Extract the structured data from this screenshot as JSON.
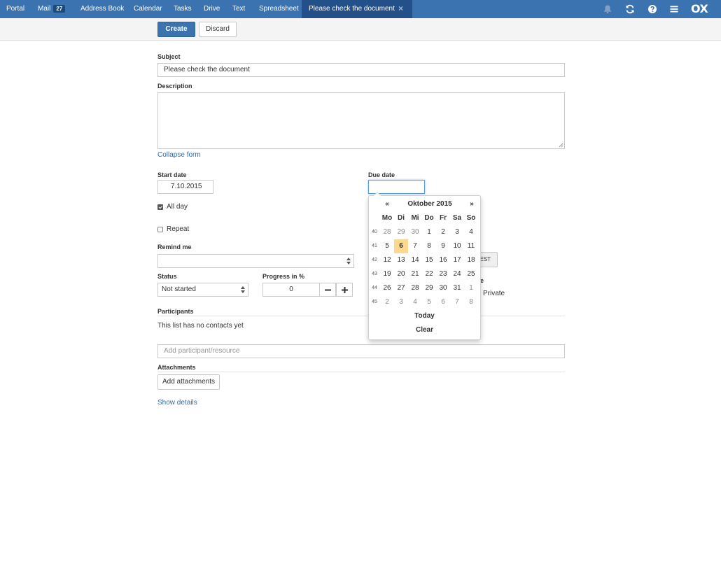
{
  "nav": {
    "items": [
      "Portal",
      "Mail",
      "Address Book",
      "Calendar",
      "Tasks",
      "Drive",
      "Text",
      "Spreadsheet"
    ],
    "mail_badge": "27",
    "active_tab": "Please check the document",
    "close_glyph": "×",
    "icons": [
      "bell-icon",
      "refresh-icon",
      "help-icon",
      "menu-icon"
    ],
    "logo": "OX"
  },
  "toolbar": {
    "create_label": "Create",
    "discard_label": "Discard"
  },
  "form": {
    "subject_label": "Subject",
    "subject_value": "Please check the document",
    "description_label": "Description",
    "collapse_link": "Collapse form",
    "start_date_label": "Start date",
    "start_date_value": "7.10.2015",
    "due_date_label": "Due date",
    "all_day_label": "All day",
    "repeat_label": "Repeat",
    "remind_label": "Remind me",
    "status_label": "Status",
    "status_value": "Not started",
    "progress_label": "Progress in %",
    "progress_value": "0",
    "partial_button": "EST",
    "partial_label": "e",
    "private_label": "Private",
    "participants_label": "Participants",
    "no_contacts": "This list has no contacts yet",
    "participant_placeholder": "Add participant/resource",
    "attachments_label": "Attachments",
    "add_attachments": "Add attachments",
    "show_details": "Show details"
  },
  "datepicker": {
    "prev": "«",
    "next": "»",
    "title": "Oktober 2015",
    "weekdays": [
      "Mo",
      "Di",
      "Mi",
      "Do",
      "Fr",
      "Sa",
      "So"
    ],
    "weeks": [
      {
        "week": "40",
        "days": [
          "28",
          "29",
          "30",
          "1",
          "2",
          "3",
          "4"
        ]
      },
      {
        "week": "41",
        "days": [
          "5",
          "6",
          "7",
          "8",
          "9",
          "10",
          "11"
        ]
      },
      {
        "week": "42",
        "days": [
          "12",
          "13",
          "14",
          "15",
          "16",
          "17",
          "18"
        ]
      },
      {
        "week": "43",
        "days": [
          "19",
          "20",
          "21",
          "22",
          "23",
          "24",
          "25"
        ]
      },
      {
        "week": "44",
        "days": [
          "26",
          "27",
          "28",
          "29",
          "30",
          "31",
          "1"
        ]
      },
      {
        "week": "45",
        "days": [
          "2",
          "3",
          "4",
          "5",
          "6",
          "7",
          "8"
        ]
      }
    ],
    "today_label": "Today",
    "clear_label": "Clear"
  },
  "colors": {
    "accent": "#3a73b0",
    "active_tab": "#245089",
    "link": "#2a6db0",
    "today_highlight": "#fcd98e"
  }
}
